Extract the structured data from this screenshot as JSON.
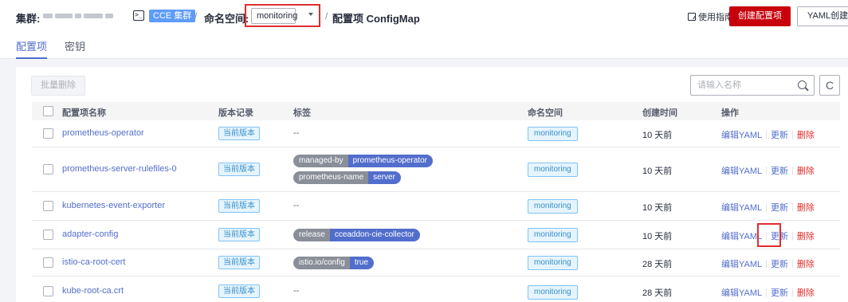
{
  "header": {
    "cluster_label": "集群:",
    "cce_tag": "CCE 集群",
    "namespace_label": "命名空间:",
    "namespace_value": "monitoring",
    "page_title": "配置项 ConfigMap",
    "guide": "使用指南",
    "create_button": "创建配置项",
    "yaml_button": "YAML创建"
  },
  "tabs": [
    "配置项",
    "密钥"
  ],
  "toolbar": {
    "batch_delete": "批量删除",
    "search_placeholder": "请输入名称",
    "refresh_glyph": "C"
  },
  "columns": [
    "配置项名称",
    "版本记录",
    "标签",
    "命名空间",
    "创建时间",
    "操作"
  ],
  "rows": [
    {
      "name": "prometheus-operator",
      "version": "当前版本",
      "labels_text": "--",
      "namespace": "monitoring",
      "created": "10 天前"
    },
    {
      "name": "prometheus-server-rulefiles-0",
      "version": "当前版本",
      "labels": [
        {
          "key": "managed-by",
          "value": "prometheus-operator"
        },
        {
          "key": "prometheus-name",
          "value": "server"
        }
      ],
      "namespace": "monitoring",
      "created": "10 天前"
    },
    {
      "name": "kubernetes-event-exporter",
      "version": "当前版本",
      "labels_text": "--",
      "namespace": "monitoring",
      "created": "10 天前"
    },
    {
      "name": "adapter-config",
      "version": "当前版本",
      "labels": [
        {
          "key": "release",
          "value": "cceaddon-cie-collector"
        }
      ],
      "namespace": "monitoring",
      "created": "10 天前"
    },
    {
      "name": "istio-ca-root-cert",
      "version": "当前版本",
      "labels": [
        {
          "key": "istio.io/config",
          "value": "true"
        }
      ],
      "namespace": "monitoring",
      "created": "28 天前"
    },
    {
      "name": "kube-root-ca.crt",
      "version": "当前版本",
      "labels_text": "--",
      "namespace": "monitoring",
      "created": "28 天前"
    }
  ],
  "ops": {
    "edit_yaml": "编辑YAML",
    "update": "更新",
    "delete": "删除",
    "separator": "|"
  },
  "colors": {
    "brand_red": "#c7000b",
    "link_blue": "#526ecc",
    "highlight_red": "#e02d2d",
    "tag_blue": "#3790c8"
  }
}
